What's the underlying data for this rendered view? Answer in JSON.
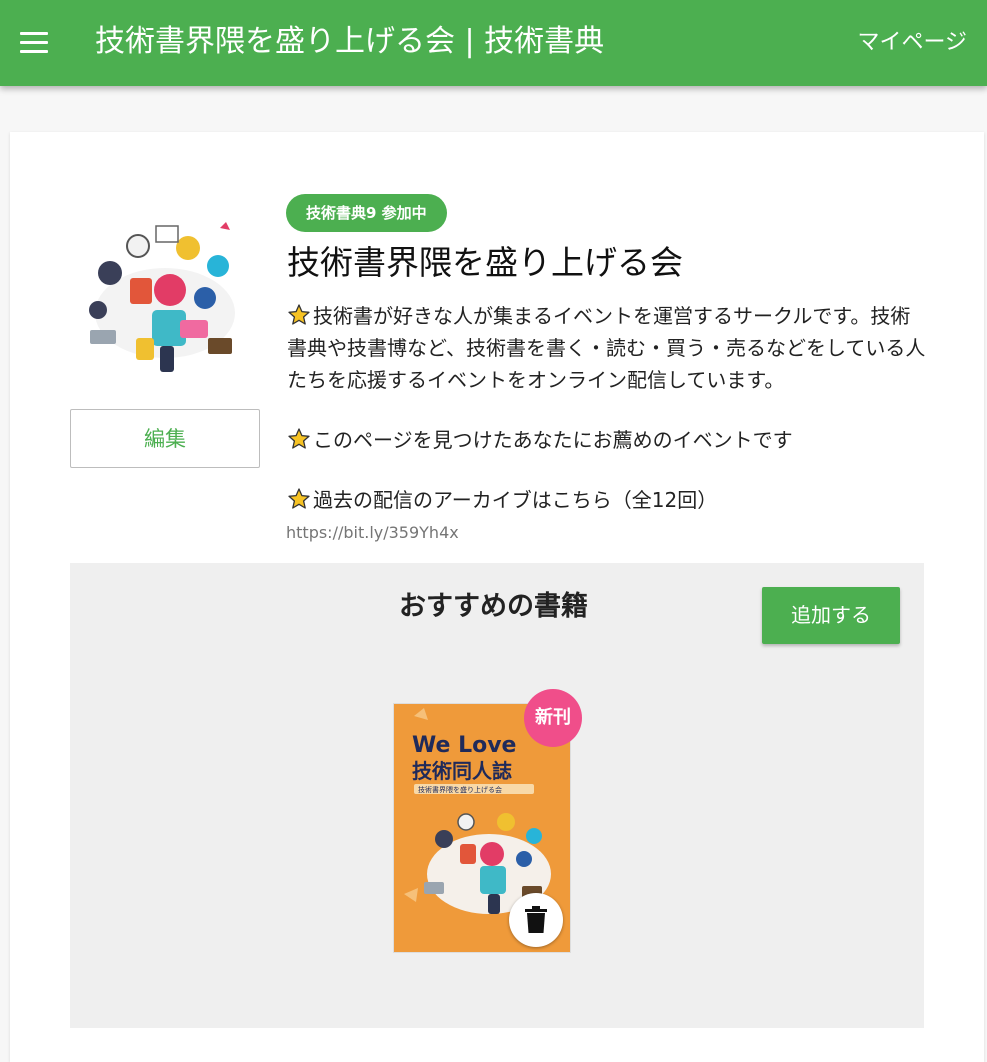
{
  "appbar": {
    "title": "技術書界隈を盛り上げる会 | 技術書典",
    "mypage_label": "マイページ",
    "color": "#4caf50"
  },
  "circle": {
    "badge": "技術書典9 参加中",
    "name": "技術書界隈を盛り上げる会",
    "description": [
      "技術書が好きな人が集まるイベントを運営するサークルです。技術書典や技書博など、技術書を書く・読む・買う・売るなどをしている人たちを応援するイベントをオンライン配信しています。",
      "このページを見つけたあなたにお薦めのイベントです",
      "過去の配信のアーカイブはこちら（全12回）"
    ],
    "link": "https://bit.ly/359Yh4x",
    "edit_label": "編集"
  },
  "recommended": {
    "title": "おすすめの書籍",
    "add_label": "追加する",
    "books": [
      {
        "cover_title_line1": "We Love",
        "cover_title_line2": "技術同人誌",
        "cover_subtitle": "技術書界隈を盛り上げる会",
        "badge": "新刊"
      }
    ]
  },
  "colors": {
    "accent": "#4caf50",
    "new_badge": "#f04e8a",
    "cover": "#ef9a3a"
  }
}
